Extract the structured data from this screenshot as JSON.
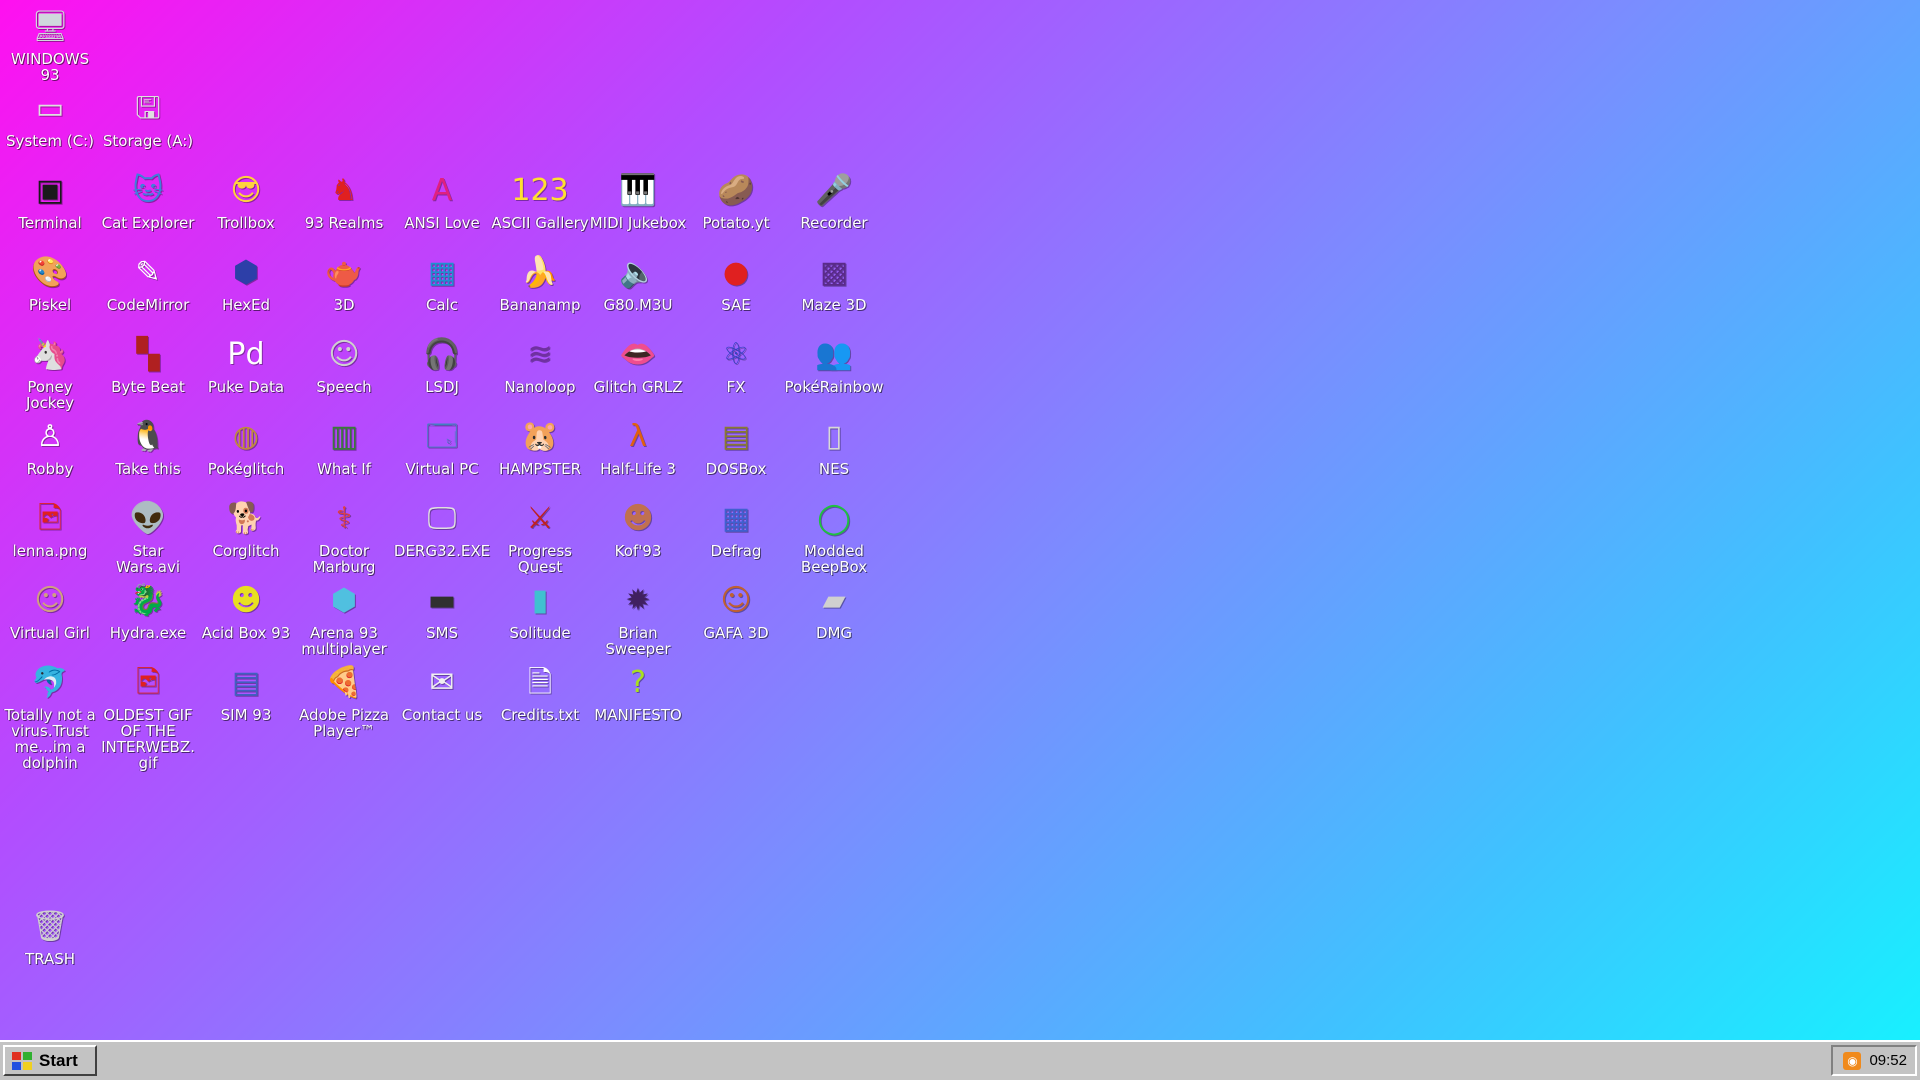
{
  "desktop": {
    "icons": [
      {
        "label": "WINDOWS 93",
        "glyph": "🖥",
        "icon": "computer-icon",
        "color": "#cfd8dc"
      },
      {
        "label": "System (C:)",
        "glyph": "▭",
        "icon": "drive-icon",
        "color": "#e0e0e0"
      },
      {
        "label": "Storage (A:)",
        "glyph": "🖫",
        "icon": "floppy-drive-icon",
        "color": "#e0e0e0"
      },
      {
        "label": "Terminal",
        "glyph": "▣",
        "icon": "terminal-icon",
        "color": "#1a1a1a"
      },
      {
        "label": "Cat Explorer",
        "glyph": "🐱",
        "icon": "cat-globe-icon",
        "color": "#3f7fdc"
      },
      {
        "label": "Trollbox",
        "glyph": "😎",
        "icon": "trollbox-icon",
        "color": "#ffd23d"
      },
      {
        "label": "93 Realms",
        "glyph": "♞",
        "icon": "realms-icon",
        "color": "#e02020"
      },
      {
        "label": "ANSI Love",
        "glyph": "A",
        "icon": "ansi-icon",
        "color": "#e0207f"
      },
      {
        "label": "ASCII Gallery",
        "glyph": "123",
        "icon": "ascii-gallery-icon",
        "color": "#ffe030"
      },
      {
        "label": "MIDI Jukebox",
        "glyph": "🎹",
        "icon": "piano-icon",
        "color": "#202020"
      },
      {
        "label": "Potato.yt",
        "glyph": "🥔",
        "icon": "potato-icon",
        "color": "#b37d43"
      },
      {
        "label": "Recorder",
        "glyph": "🎤",
        "icon": "microphone-icon",
        "color": "#303030"
      },
      {
        "label": "Piskel",
        "glyph": "🎨",
        "icon": "palette-icon",
        "color": "#f0c060"
      },
      {
        "label": "CodeMirror",
        "glyph": "✎",
        "icon": "codemirror-icon",
        "color": "#ffffff"
      },
      {
        "label": "HexEd",
        "glyph": "⬢",
        "icon": "hexagon-icon",
        "color": "#2d3fa8"
      },
      {
        "label": "3D",
        "glyph": "🫖",
        "icon": "teapot-icon",
        "color": "#e8a0c0"
      },
      {
        "label": "Calc",
        "glyph": "▦",
        "icon": "calculator-icon",
        "color": "#208fd0"
      },
      {
        "label": "Bananamp",
        "glyph": "🍌",
        "icon": "banana-icon",
        "color": "#ffe14a"
      },
      {
        "label": "G80.M3U",
        "glyph": "🔈",
        "icon": "audio-file-icon",
        "color": "#ffffff"
      },
      {
        "label": "SAE",
        "glyph": "●",
        "icon": "amiga-ball-icon",
        "color": "#e02020"
      },
      {
        "label": "Maze 3D",
        "glyph": "▩",
        "icon": "maze-icon",
        "color": "#5a2a8a"
      },
      {
        "label": "Poney\nJockey",
        "glyph": "🦄",
        "icon": "pony-icon",
        "color": "#c070e0"
      },
      {
        "label": "Byte Beat",
        "glyph": "▚",
        "icon": "bytebeat-icon",
        "color": "#b02020"
      },
      {
        "label": "Puke Data",
        "glyph": "Pd",
        "icon": "pd-icon",
        "color": "#ffffff"
      },
      {
        "label": "Speech",
        "glyph": "☺",
        "icon": "speech-face-icon",
        "color": "#d0d0d0"
      },
      {
        "label": "LSDJ",
        "glyph": "🎧",
        "icon": "lsdj-icon",
        "color": "#a040d0"
      },
      {
        "label": "Nanoloop",
        "glyph": "≋",
        "icon": "nanoloop-icon",
        "color": "#7030a0"
      },
      {
        "label": "Glitch GRLZ",
        "glyph": "👄",
        "icon": "lips-icon",
        "color": "#e02030"
      },
      {
        "label": "FX",
        "glyph": "⚛",
        "icon": "atom-icon",
        "color": "#3040c0"
      },
      {
        "label": "PokéRainbow",
        "glyph": "👥",
        "icon": "pokerainbow-icon",
        "color": "#405030"
      },
      {
        "label": "Robby",
        "glyph": "♙",
        "icon": "robby-icon",
        "color": "#ffffff"
      },
      {
        "label": "Take this",
        "glyph": "🐧",
        "icon": "take-this-icon",
        "color": "#ff7a20"
      },
      {
        "label": "Pokéglitch",
        "glyph": "◍",
        "icon": "pokeglitch-icon",
        "color": "#c08a40"
      },
      {
        "label": "What If",
        "glyph": "▥",
        "icon": "what-if-icon",
        "color": "#3a7a3a"
      },
      {
        "label": "Virtual PC",
        "glyph": "🗔",
        "icon": "virtual-pc-icon",
        "color": "#4080c0"
      },
      {
        "label": "HAMPSTER",
        "glyph": "🐹",
        "icon": "hamster-icon",
        "color": "#e0e0e0"
      },
      {
        "label": "Half-Life 3",
        "glyph": "λ",
        "icon": "lambda-icon",
        "color": "#e06010"
      },
      {
        "label": "DOSBox",
        "glyph": "▤",
        "icon": "dosbox-icon",
        "color": "#8a7a30"
      },
      {
        "label": "NES",
        "glyph": "▯",
        "icon": "nes-icon",
        "color": "#d8d8d8"
      },
      {
        "label": "lenna.png",
        "glyph": "🖻",
        "icon": "image-file-icon",
        "color": "#e02020"
      },
      {
        "label": "Star\nWars.avi",
        "glyph": "👽",
        "icon": "yoda-icon",
        "color": "#40a040"
      },
      {
        "label": "Corglitch",
        "glyph": "🐕",
        "icon": "corgi-icon",
        "color": "#e09050"
      },
      {
        "label": "Doctor\nMarburg",
        "glyph": "⚕",
        "icon": "doctor-icon",
        "color": "#e04040"
      },
      {
        "label": "DERG32.EXE",
        "glyph": "🖵",
        "icon": "derg-icon",
        "color": "#e0e0e0"
      },
      {
        "label": "Progress\nQuest",
        "glyph": "⚔",
        "icon": "swords-icon",
        "color": "#c02020"
      },
      {
        "label": "Kof'93",
        "glyph": "☻",
        "icon": "kof-icon",
        "color": "#c07050"
      },
      {
        "label": "Defrag",
        "glyph": "▦",
        "icon": "defrag-icon",
        "color": "#4060d0"
      },
      {
        "label": "Modded\nBeepBox",
        "glyph": "◯",
        "icon": "beepbox-icon",
        "color": "#20c040"
      },
      {
        "label": "Virtual Girl",
        "glyph": "☺",
        "icon": "virtual-girl-icon",
        "color": "#d0a080"
      },
      {
        "label": "Hydra.exe",
        "glyph": "🐉",
        "icon": "hydra-icon",
        "color": "#30a040"
      },
      {
        "label": "Acid Box 93",
        "glyph": "☻",
        "icon": "smiley-icon",
        "color": "#e8e020"
      },
      {
        "label": "Arena 93\nmultiplayer",
        "glyph": "⬢",
        "icon": "cube-icon",
        "color": "#50c0e0"
      },
      {
        "label": "SMS",
        "glyph": "▬",
        "icon": "sms-console-icon",
        "color": "#303030"
      },
      {
        "label": "Solitude",
        "glyph": "▮",
        "icon": "solitude-icon",
        "color": "#40c0d0"
      },
      {
        "label": "Brian\nSweeper",
        "glyph": "✹",
        "icon": "mine-icon",
        "color": "#402060"
      },
      {
        "label": "GAFA 3D",
        "glyph": "☺",
        "icon": "gafa-face-icon",
        "color": "#c06030"
      },
      {
        "label": "DMG",
        "glyph": "▰",
        "icon": "dmg-icon",
        "color": "#d0d0d0"
      },
      {
        "label": "Totally not a\nvirus.Trust\nme...im a\ndolphin",
        "glyph": "🐬",
        "icon": "dolphin-icon",
        "color": "#40a0e0"
      },
      {
        "label": "OLDEST GIF\nOF THE\nINTERWEBZ.\ngif",
        "glyph": "🖻",
        "icon": "gif-file-icon",
        "color": "#e02020"
      },
      {
        "label": "SIM 93",
        "glyph": "▤",
        "icon": "sim-icon",
        "color": "#4060c0"
      },
      {
        "label": "Adobe Pizza\nPlayer™",
        "glyph": "🍕",
        "icon": "pizza-icon",
        "color": "#e0a040"
      },
      {
        "label": "Contact us",
        "glyph": "✉",
        "icon": "contact-icon",
        "color": "#f0f0f0"
      },
      {
        "label": "Credits.txt",
        "glyph": "🗎",
        "icon": "text-file-icon",
        "color": "#ffffff"
      },
      {
        "label": "MANIFESTO",
        "glyph": "?",
        "icon": "question-icon",
        "color": "#a8e020"
      },
      {
        "label": "TRASH",
        "glyph": "🗑",
        "icon": "trash-icon",
        "color": "#d0d0d0"
      }
    ]
  },
  "taskbar": {
    "start_label": "Start",
    "clock": "09:52"
  }
}
